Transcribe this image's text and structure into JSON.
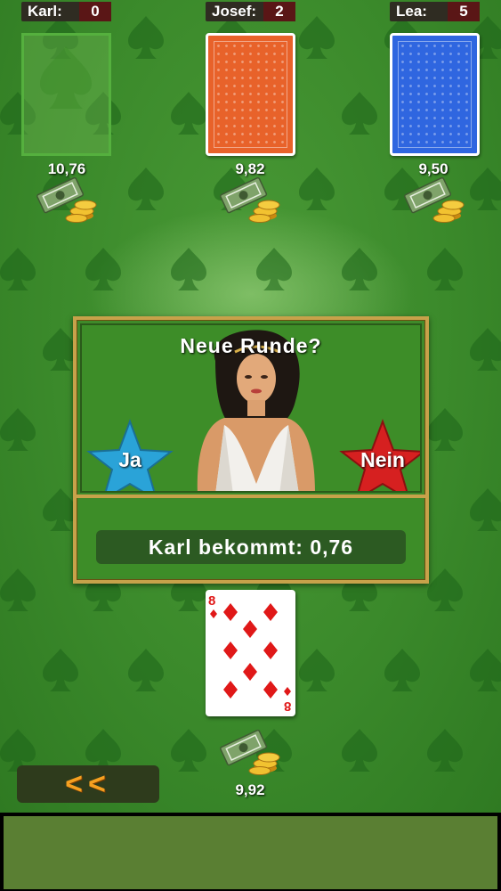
{
  "players": [
    {
      "name": "Karl:",
      "points": "0",
      "money": "10,76"
    },
    {
      "name": "Josef:",
      "points": "2",
      "money": "9,82"
    },
    {
      "name": "Lea:",
      "points": "5",
      "money": "9,50"
    }
  ],
  "dialog": {
    "title": "Neue Runde?",
    "yes_label": "Ja",
    "no_label": "Nein",
    "result_text": "Karl bekommt: 0,76"
  },
  "played_card": {
    "rank": "8",
    "suit": "diamonds",
    "color": "#e01818"
  },
  "pot": {
    "amount": "9,92"
  },
  "back_button": {
    "label": "<<"
  },
  "colors": {
    "felt": "#3d8a2c",
    "orange_back": "#e8622a",
    "blue_back": "#2f66e0",
    "star_yes": "#2aa3d8",
    "star_no": "#d62020",
    "gold_frame": "#c7a24a"
  }
}
